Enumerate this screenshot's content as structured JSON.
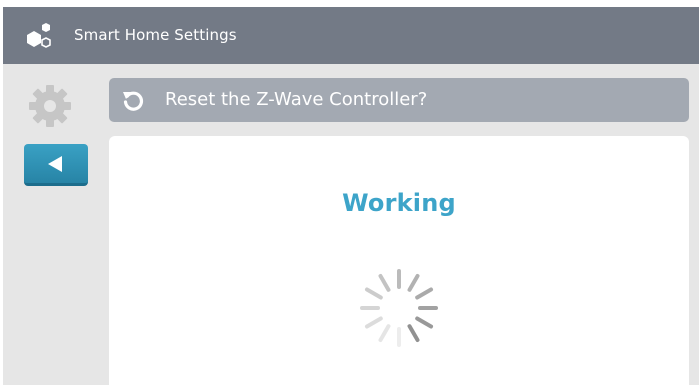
{
  "header": {
    "title": "Smart Home Settings",
    "icon": "smart-home-cubes-icon"
  },
  "sidebar": {
    "settings_icon": "gear-icon",
    "back_icon": "back-arrow-icon"
  },
  "dialog": {
    "title": "Reset the Z-Wave Controller?",
    "title_icon": "reset-icon",
    "status": "Working",
    "spinner_icon": "loading-spinner-icon"
  },
  "colors": {
    "header_bg": "#737a86",
    "title_bar_bg": "#a3a9b2",
    "accent": "#3da4c9",
    "back_button": "#2f8fb3",
    "panel_bg": "#e6e6e6"
  }
}
